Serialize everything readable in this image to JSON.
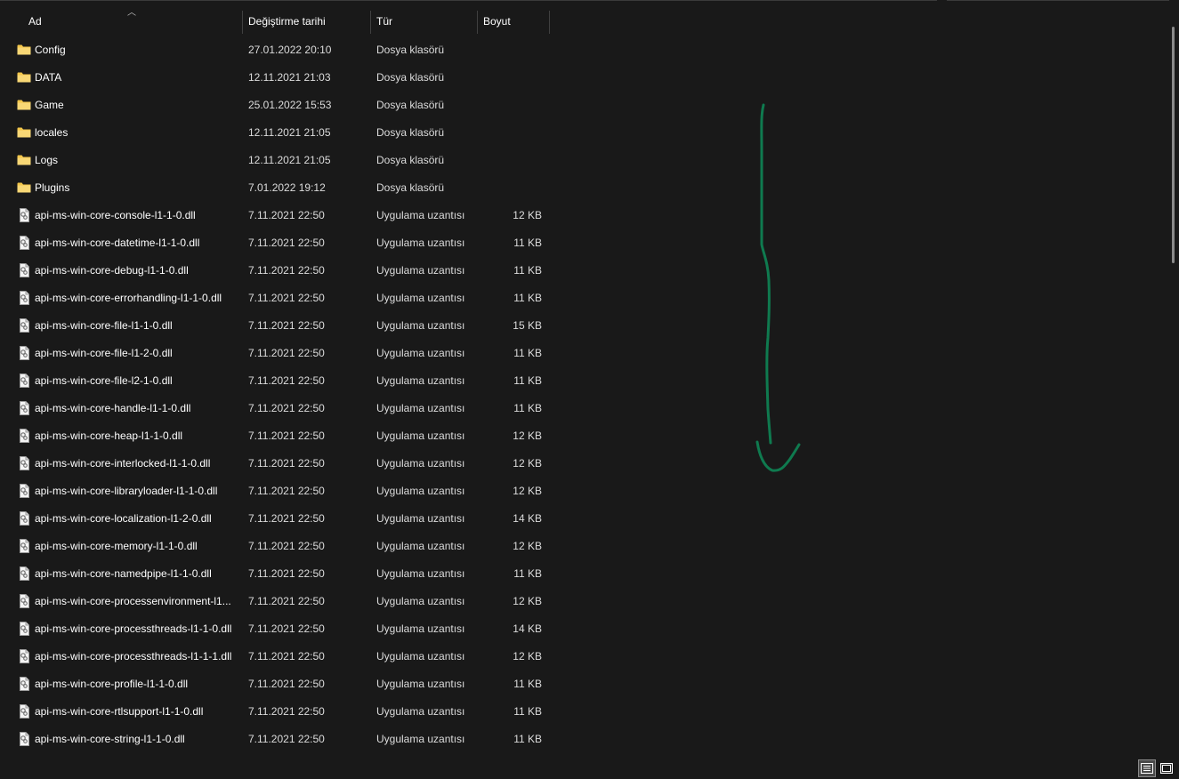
{
  "columns": {
    "name": "Ad",
    "date": "Değiştirme tarihi",
    "type": "Tür",
    "size": "Boyut"
  },
  "files": [
    {
      "name": "Config",
      "date": "27.01.2022 20:10",
      "type": "Dosya klasörü",
      "size": "",
      "icon": "folder-icon"
    },
    {
      "name": "DATA",
      "date": "12.11.2021 21:03",
      "type": "Dosya klasörü",
      "size": "",
      "icon": "folder-icon"
    },
    {
      "name": "Game",
      "date": "25.01.2022 15:53",
      "type": "Dosya klasörü",
      "size": "",
      "icon": "folder-icon"
    },
    {
      "name": "locales",
      "date": "12.11.2021 21:05",
      "type": "Dosya klasörü",
      "size": "",
      "icon": "folder-icon"
    },
    {
      "name": "Logs",
      "date": "12.11.2021 21:05",
      "type": "Dosya klasörü",
      "size": "",
      "icon": "folder-icon"
    },
    {
      "name": "Plugins",
      "date": "7.01.2022 19:12",
      "type": "Dosya klasörü",
      "size": "",
      "icon": "folder-icon"
    },
    {
      "name": "api-ms-win-core-console-l1-1-0.dll",
      "date": "7.11.2021 22:50",
      "type": "Uygulama uzantısı",
      "size": "12 KB",
      "icon": "dll-file-icon"
    },
    {
      "name": "api-ms-win-core-datetime-l1-1-0.dll",
      "date": "7.11.2021 22:50",
      "type": "Uygulama uzantısı",
      "size": "11 KB",
      "icon": "dll-file-icon"
    },
    {
      "name": "api-ms-win-core-debug-l1-1-0.dll",
      "date": "7.11.2021 22:50",
      "type": "Uygulama uzantısı",
      "size": "11 KB",
      "icon": "dll-file-icon"
    },
    {
      "name": "api-ms-win-core-errorhandling-l1-1-0.dll",
      "date": "7.11.2021 22:50",
      "type": "Uygulama uzantısı",
      "size": "11 KB",
      "icon": "dll-file-icon"
    },
    {
      "name": "api-ms-win-core-file-l1-1-0.dll",
      "date": "7.11.2021 22:50",
      "type": "Uygulama uzantısı",
      "size": "15 KB",
      "icon": "dll-file-icon"
    },
    {
      "name": "api-ms-win-core-file-l1-2-0.dll",
      "date": "7.11.2021 22:50",
      "type": "Uygulama uzantısı",
      "size": "11 KB",
      "icon": "dll-file-icon"
    },
    {
      "name": "api-ms-win-core-file-l2-1-0.dll",
      "date": "7.11.2021 22:50",
      "type": "Uygulama uzantısı",
      "size": "11 KB",
      "icon": "dll-file-icon"
    },
    {
      "name": "api-ms-win-core-handle-l1-1-0.dll",
      "date": "7.11.2021 22:50",
      "type": "Uygulama uzantısı",
      "size": "11 KB",
      "icon": "dll-file-icon"
    },
    {
      "name": "api-ms-win-core-heap-l1-1-0.dll",
      "date": "7.11.2021 22:50",
      "type": "Uygulama uzantısı",
      "size": "12 KB",
      "icon": "dll-file-icon"
    },
    {
      "name": "api-ms-win-core-interlocked-l1-1-0.dll",
      "date": "7.11.2021 22:50",
      "type": "Uygulama uzantısı",
      "size": "12 KB",
      "icon": "dll-file-icon"
    },
    {
      "name": "api-ms-win-core-libraryloader-l1-1-0.dll",
      "date": "7.11.2021 22:50",
      "type": "Uygulama uzantısı",
      "size": "12 KB",
      "icon": "dll-file-icon"
    },
    {
      "name": "api-ms-win-core-localization-l1-2-0.dll",
      "date": "7.11.2021 22:50",
      "type": "Uygulama uzantısı",
      "size": "14 KB",
      "icon": "dll-file-icon"
    },
    {
      "name": "api-ms-win-core-memory-l1-1-0.dll",
      "date": "7.11.2021 22:50",
      "type": "Uygulama uzantısı",
      "size": "12 KB",
      "icon": "dll-file-icon"
    },
    {
      "name": "api-ms-win-core-namedpipe-l1-1-0.dll",
      "date": "7.11.2021 22:50",
      "type": "Uygulama uzantısı",
      "size": "11 KB",
      "icon": "dll-file-icon"
    },
    {
      "name": "api-ms-win-core-processenvironment-l1...",
      "date": "7.11.2021 22:50",
      "type": "Uygulama uzantısı",
      "size": "12 KB",
      "icon": "dll-file-icon"
    },
    {
      "name": "api-ms-win-core-processthreads-l1-1-0.dll",
      "date": "7.11.2021 22:50",
      "type": "Uygulama uzantısı",
      "size": "14 KB",
      "icon": "dll-file-icon"
    },
    {
      "name": "api-ms-win-core-processthreads-l1-1-1.dll",
      "date": "7.11.2021 22:50",
      "type": "Uygulama uzantısı",
      "size": "12 KB",
      "icon": "dll-file-icon"
    },
    {
      "name": "api-ms-win-core-profile-l1-1-0.dll",
      "date": "7.11.2021 22:50",
      "type": "Uygulama uzantısı",
      "size": "11 KB",
      "icon": "dll-file-icon"
    },
    {
      "name": "api-ms-win-core-rtlsupport-l1-1-0.dll",
      "date": "7.11.2021 22:50",
      "type": "Uygulama uzantısı",
      "size": "11 KB",
      "icon": "dll-file-icon"
    },
    {
      "name": "api-ms-win-core-string-l1-1-0.dll",
      "date": "7.11.2021 22:50",
      "type": "Uygulama uzantısı",
      "size": "11 KB",
      "icon": "dll-file-icon"
    }
  ],
  "view_buttons": [
    {
      "icon": "details-view-icon",
      "active": true
    },
    {
      "icon": "large-icons-view-icon",
      "active": false
    }
  ],
  "colors": {
    "background": "#191919",
    "folder": "#f3c64a",
    "annotation": "#0f7a4f"
  }
}
